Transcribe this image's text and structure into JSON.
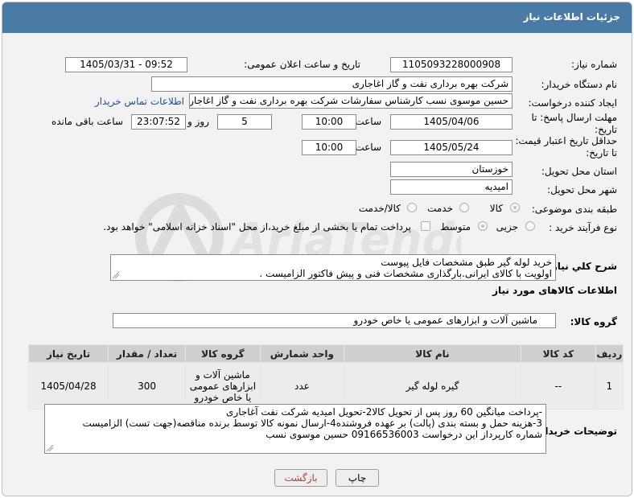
{
  "header": {
    "title": "جزئیات اطلاعات نیاز"
  },
  "fields": {
    "need_number_label": "شماره نیاز:",
    "need_number": "1105093228000908",
    "announce_label": "تاریخ و ساعت اعلان عمومی:",
    "announce_value": "1405/03/31 - 09:52",
    "buyer_org_label": "نام دستگاه خریدار:",
    "buyer_org": "شرکت بهره برداری نفت و گاز اغاجاری",
    "creator_label": "ایجاد کننده درخواست:",
    "creator": "حسین موسوی نسب کارشناس سفارشات شرکت بهره برداری نفت و گاز اغاجار",
    "contact_link": "اطلاعات تماس خریدار",
    "deadline_label_1": "مهلت ارسال پاسخ: تا",
    "deadline_label_2": "تاریخ:",
    "deadline_date": "1405/04/06",
    "time_label": "ساعت",
    "deadline_time": "10:00",
    "days_value": "5",
    "days_label": "روز و",
    "remaining_time": "23:07:52",
    "remaining_label": "ساعت باقی مانده",
    "price_label_1": "حداقل تاریخ اعتبار قیمت:",
    "price_label_2": "تا تاریخ:",
    "price_date": "1405/05/24",
    "price_time": "10:00",
    "province_label": "استان محل تحویل:",
    "province": "خوزستان",
    "city_label": "شهر محل تحویل:",
    "city": "امیدیه",
    "category_label": "طبقه بندی موضوعی:",
    "category_options": [
      "کالا",
      "خدمت",
      "کالا/خدمت"
    ],
    "process_label": "نوع فرآیند خرید :",
    "process_options": [
      "جزیی",
      "متوسط"
    ],
    "payment_note": "پرداخت تمام یا بخشی از مبلغ خرید،از محل \"اسناد خزانه اسلامی\" خواهد بود."
  },
  "description": {
    "label": "شرح کلي نياز:",
    "line1": "خرید لوله گیر طبق مشخصات فایل پیوست",
    "line2": "اولویت با کالای ایرانی.بارگذاری مشخصات فنی و پیش فاکتور الزامیست ."
  },
  "goods": {
    "section_title": "اطلاعات کالاهای مورد نیاز",
    "group_label": "گروه کالا:",
    "group_value": "ماشین آلات و ابزارهای عمومی یا خاص خودرو",
    "columns": [
      "ردیف",
      "کد کالا",
      "نام کالا",
      "واحد شمارش",
      "گروه کالا",
      "تعداد / مقدار",
      "تاریخ نیاز"
    ],
    "rows": [
      {
        "row": "1",
        "code": "--",
        "name": "گیره لوله گیر",
        "unit": "عدد",
        "group": "ماشین آلات و ابزارهای عمومی یا خاص خودرو",
        "qty": "300",
        "date": "1405/04/28"
      }
    ]
  },
  "buyer_notes": {
    "label": "توضیحات خریدار:",
    "line1": "-پرداخت میانگین 60 روز پس از تحویل کالا2-تحویل امیدیه شرکت نفت آغاجاری",
    "line2": "3-هزینه حمل  و بسته بندی (پالت) بر عهده فروشنده4-ارسال نمونه کالا توسط برنده مناقصه(جهت تست) الزامیست",
    "line3": "شماره کارپرداز این درخواست 09166536003 حسین موسوی نسب"
  },
  "buttons": {
    "print": "چاپ",
    "back": "بازگشت"
  },
  "colors": {
    "header_bg": "#4a7ba7",
    "page_bg": "#f2f2f2",
    "back_text": "#c0392b"
  }
}
